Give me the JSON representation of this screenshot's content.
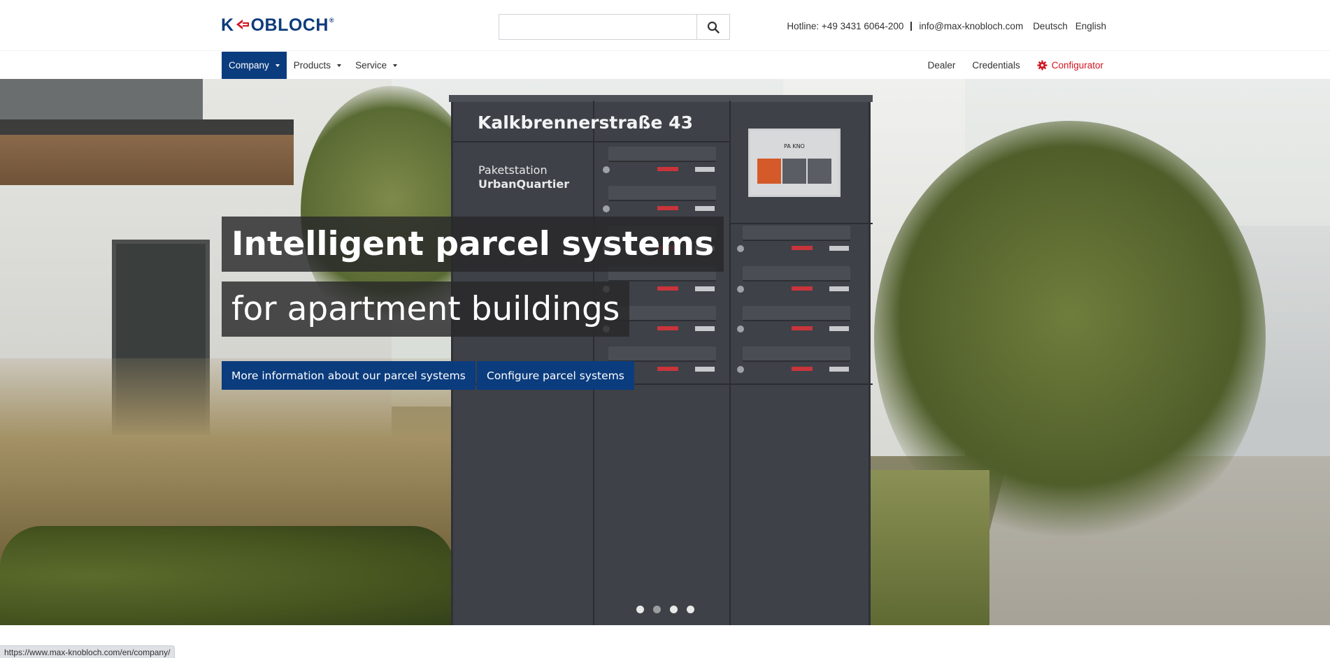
{
  "header": {
    "logo": {
      "text_before": "K",
      "text_after": "OBLOCH",
      "reg": "®",
      "color": "#0d3b7a",
      "accent_color": "#d1131f"
    },
    "search": {
      "placeholder": "",
      "value": "",
      "button_icon": "search-icon"
    },
    "hotline": "Hotline: +49 3431 6064-200",
    "email": "info@max-knobloch.com",
    "languages": [
      "Deutsch",
      "English"
    ]
  },
  "nav": {
    "left": [
      {
        "label": "Company",
        "active": true
      },
      {
        "label": "Products",
        "active": false
      },
      {
        "label": "Service",
        "active": false
      }
    ],
    "right": {
      "dealer": "Dealer",
      "credentials": "Credentials",
      "configurator": "Configurator",
      "configurator_icon": "gear-icon",
      "configurator_color": "#d1131f"
    },
    "active_color": "#0b3c7e"
  },
  "hero": {
    "line1": "Intelligent parcel systems",
    "line2": "for apartment buildings",
    "button1": "More information about our parcel systems",
    "button2": "Configure parcel systems",
    "slide_count": 4,
    "active_slide": 1,
    "station": {
      "name": "Kalkbrennerstraße 43",
      "sub1": "Paketstation",
      "sub2": "UrbanQuartier",
      "screen_brand": "PA KNO"
    }
  },
  "statusbar": {
    "url": "https://www.max-knobloch.com/en/company/"
  }
}
